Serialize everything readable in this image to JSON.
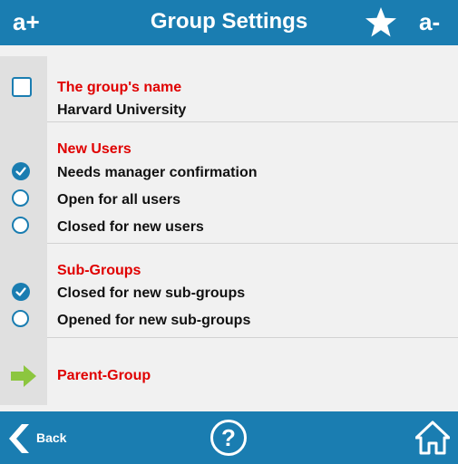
{
  "header": {
    "title": "Group Settings",
    "increase_font_label": "a+",
    "decrease_font_label": "a-",
    "favorite_icon": "star-icon"
  },
  "sections": {
    "group_name": {
      "heading": "The group's name",
      "value": "Harvard University",
      "checkbox_checked": false
    },
    "new_users": {
      "heading": "New Users",
      "options": [
        {
          "label": "Needs manager confirmation",
          "selected": true
        },
        {
          "label": "Open for all users",
          "selected": false
        },
        {
          "label": "Closed for new users",
          "selected": false
        }
      ]
    },
    "sub_groups": {
      "heading": "Sub-Groups",
      "options": [
        {
          "label": "Closed for new sub-groups",
          "selected": true
        },
        {
          "label": "Opened for new sub-groups",
          "selected": false
        }
      ]
    },
    "parent_group": {
      "label": "Parent-Group",
      "icon": "arrow-right-icon"
    }
  },
  "footer": {
    "back_label": "Back",
    "help_label": "?",
    "home_icon": "home-icon"
  },
  "colors": {
    "bar": "#1a7db1",
    "heading_red": "#e00000",
    "arrow_green": "#8cc63f"
  }
}
